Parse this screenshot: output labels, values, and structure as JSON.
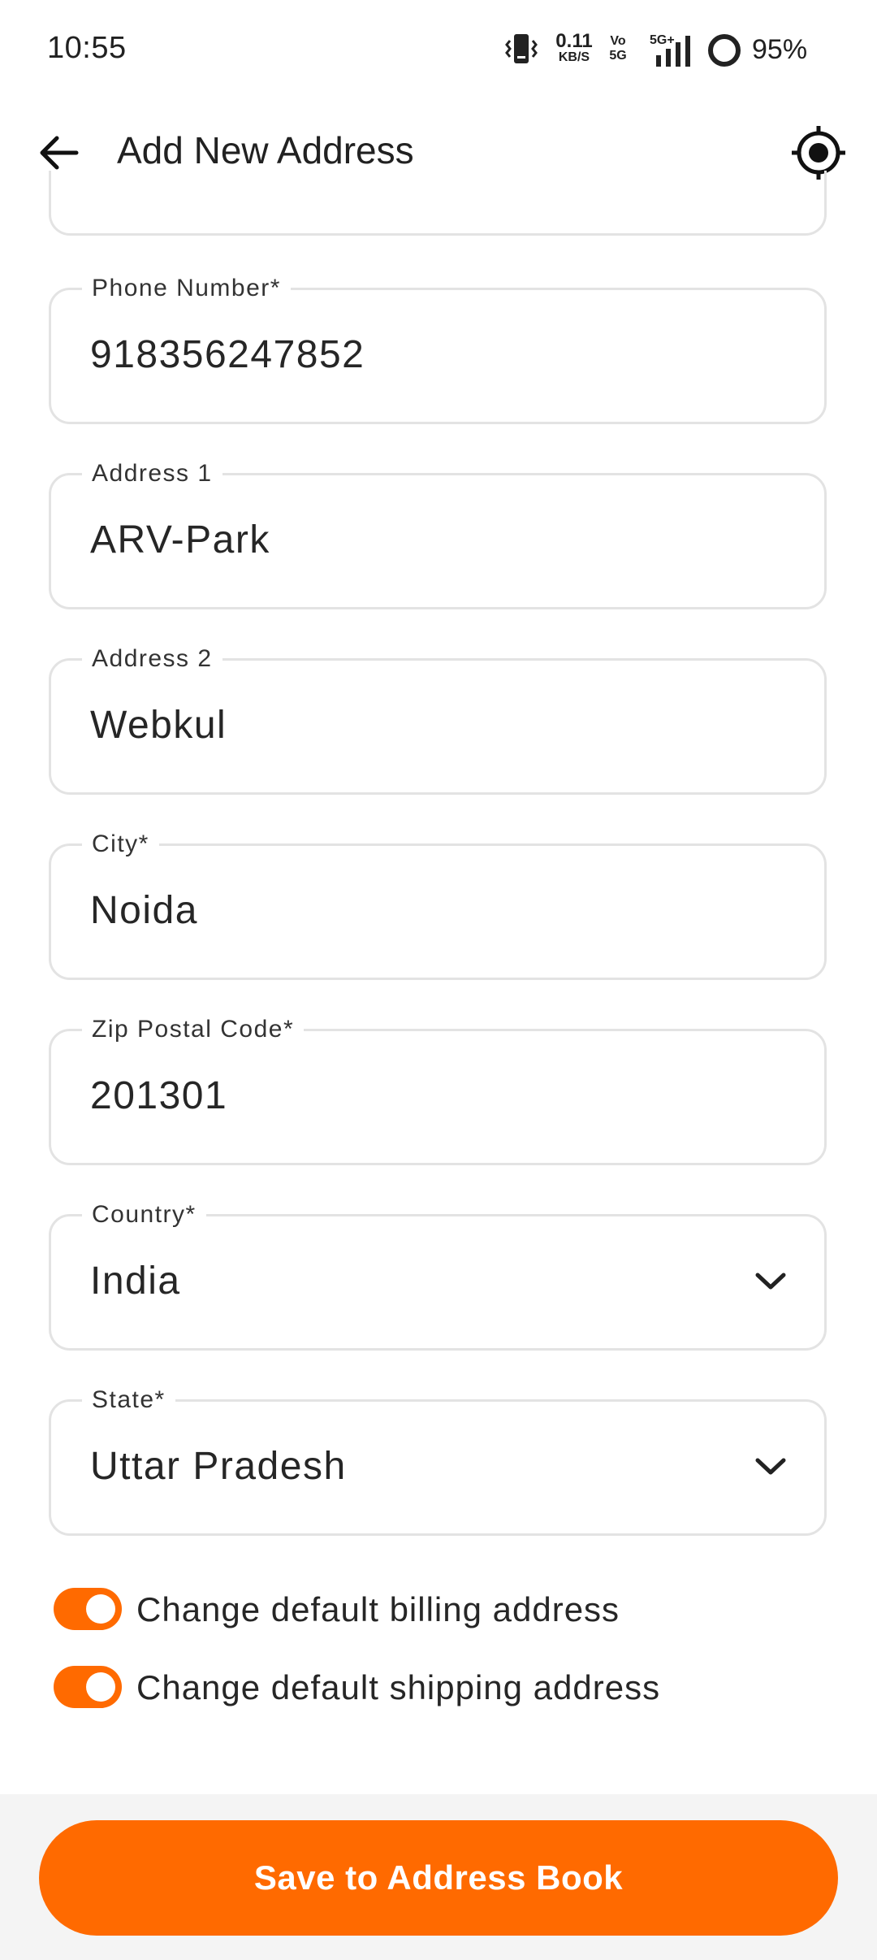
{
  "status_bar": {
    "time": "10:55",
    "net_speed_value": "0.11",
    "net_speed_unit": "KB/S",
    "volte_top": "Vo",
    "volte_bottom": "5G",
    "network": "5G+",
    "battery_percent": "95%"
  },
  "app_bar": {
    "title": "Add New Address"
  },
  "form": {
    "fields": [
      {
        "label": "Phone Number*",
        "value": "918356247852"
      },
      {
        "label": "Address 1",
        "value": "ARV-Park"
      },
      {
        "label": "Address 2",
        "value": "Webkul"
      },
      {
        "label": "City*",
        "value": "Noida"
      },
      {
        "label": "Zip Postal Code*",
        "value": "201301"
      },
      {
        "label": "Country*",
        "value": "India"
      },
      {
        "label": "State*",
        "value": "Uttar Pradesh"
      }
    ]
  },
  "toggles": [
    {
      "label": "Change default billing address",
      "on": true
    },
    {
      "label": "Change default shipping address",
      "on": true
    }
  ],
  "save_button": {
    "label": "Save to Address Book"
  },
  "colors": {
    "accent": "#ff6a00",
    "field_border": "#e3e3e3",
    "text": "#262626"
  },
  "icons": {
    "back": "arrow-left-icon",
    "locate": "gps-crosshair-icon",
    "dropdown": "chevron-down-icon"
  }
}
